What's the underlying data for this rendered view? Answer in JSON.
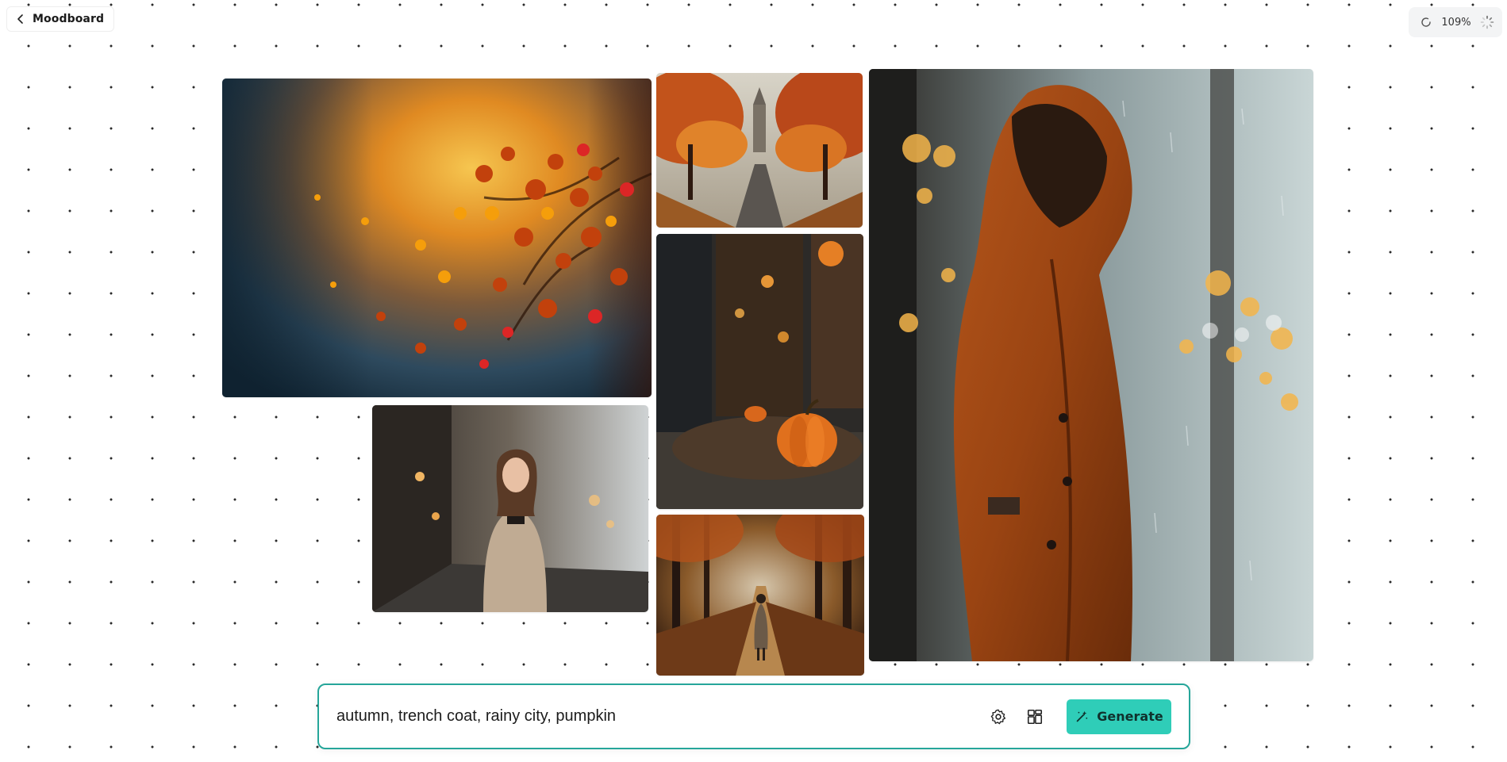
{
  "header": {
    "back_label": "Moodboard",
    "back_icon": "chevron-left-icon"
  },
  "zoom": {
    "value": "109%",
    "refresh_icon": "refresh-icon",
    "loading_icon": "loading-spinner-icon"
  },
  "board": {
    "images": [
      {
        "id": "leaves",
        "subject": "autumn maple leaves"
      },
      {
        "id": "street",
        "subject": "autumn tree-lined street"
      },
      {
        "id": "pumpkin",
        "subject": "pumpkin by shop window"
      },
      {
        "id": "woman",
        "subject": "woman in trench coat on city street"
      },
      {
        "id": "path",
        "subject": "person walking autumn forest path"
      },
      {
        "id": "coat",
        "subject": "hooded trench coat in rain"
      }
    ]
  },
  "prompt": {
    "text": "autumn, trench coat, rainy city, pumpkin",
    "settings_icon": "settings-gear-icon",
    "layout_icon": "layout-grid-icon",
    "generate_label": "Generate",
    "generate_icon": "magic-wand-icon"
  },
  "colors": {
    "accent": "#2fcdb8",
    "border": "#26a69a",
    "background": "#ffffff"
  }
}
